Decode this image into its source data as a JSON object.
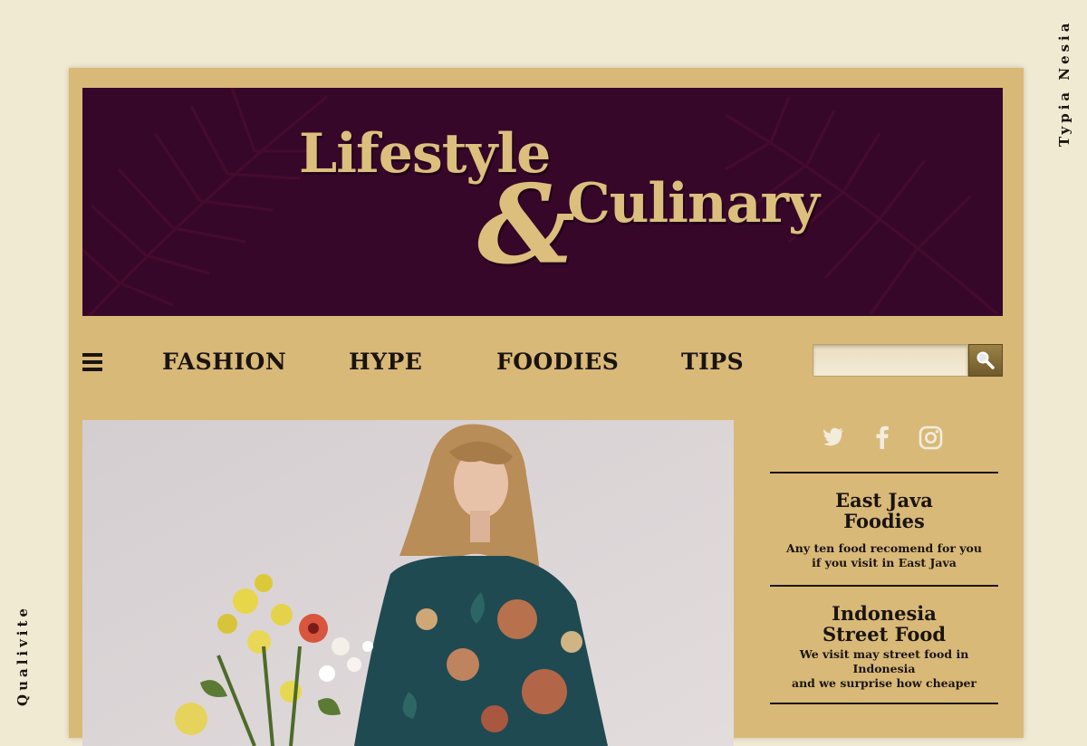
{
  "side_labels": {
    "right": "Typia Nesia",
    "left": "Qualivite"
  },
  "header": {
    "title_line1": "Lifestyle",
    "title_amp": "&",
    "title_line2": "Culinary"
  },
  "nav": {
    "items": [
      {
        "label": "FASHION"
      },
      {
        "label": "HYPE"
      },
      {
        "label": "FOODIES"
      },
      {
        "label": "TIPS"
      }
    ],
    "search": {
      "placeholder": "",
      "value": ""
    }
  },
  "social": {
    "icons": [
      "twitter-icon",
      "facebook-icon",
      "instagram-icon"
    ]
  },
  "articles": [
    {
      "title_l1": "East Java",
      "title_l2": "Foodies",
      "desc_l1": "Any ten food recomend for you",
      "desc_l2": "if you visit in East Java"
    },
    {
      "title_l1": "Indonesia",
      "title_l2": "Street Food",
      "desc_l1": "We visit may street food in Indonesia",
      "desc_l2": "and we surprise how cheaper"
    }
  ],
  "colors": {
    "page_bg": "#f1ead2",
    "frame": "#d9b978",
    "banner": "#37072a",
    "gold_text": "#dcbf7d",
    "ink": "#1a1410"
  }
}
